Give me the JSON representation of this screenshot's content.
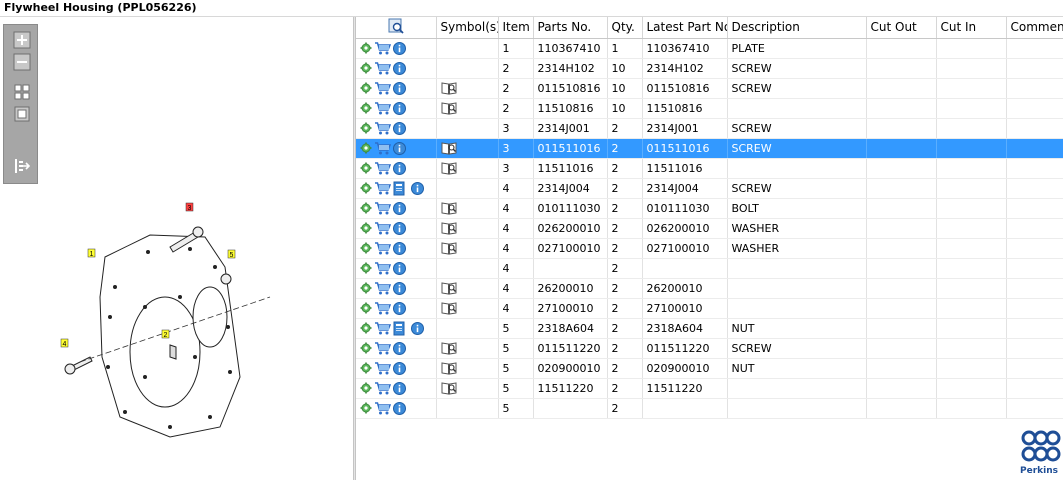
{
  "window": {
    "title": "Flywheel Housing (PPL056226)"
  },
  "table": {
    "columns": [
      "",
      "Symbol(s)",
      "Item",
      "Parts No.",
      "Qty.",
      "Latest Part No.",
      "Description",
      "Cut Out",
      "Cut In",
      "Comment"
    ],
    "rows": [
      {
        "symbol": "",
        "item": "1",
        "part_no": "110367410",
        "qty": "1",
        "latest": "110367410",
        "desc": "PLATE"
      },
      {
        "symbol": "",
        "item": "2",
        "part_no": "2314H102",
        "qty": "10",
        "latest": "2314H102",
        "desc": "SCREW"
      },
      {
        "symbol": "book",
        "item": "2",
        "part_no": "011510816",
        "qty": "10",
        "latest": "011510816",
        "desc": "SCREW"
      },
      {
        "symbol": "book",
        "item": "2",
        "part_no": "11510816",
        "qty": "10",
        "latest": "11510816",
        "desc": ""
      },
      {
        "symbol": "",
        "item": "3",
        "part_no": "2314J001",
        "qty": "2",
        "latest": "2314J001",
        "desc": "SCREW"
      },
      {
        "symbol": "book",
        "item": "3",
        "part_no": "011511016",
        "qty": "2",
        "latest": "011511016",
        "desc": "SCREW",
        "selected": true
      },
      {
        "symbol": "book",
        "item": "3",
        "part_no": "11511016",
        "qty": "2",
        "latest": "11511016",
        "desc": ""
      },
      {
        "symbol": "manual",
        "item": "4",
        "part_no": "2314J004",
        "qty": "2",
        "latest": "2314J004",
        "desc": "SCREW"
      },
      {
        "symbol": "book",
        "item": "4",
        "part_no": "010111030",
        "qty": "2",
        "latest": "010111030",
        "desc": "BOLT"
      },
      {
        "symbol": "book",
        "item": "4",
        "part_no": "026200010",
        "qty": "2",
        "latest": "026200010",
        "desc": "WASHER"
      },
      {
        "symbol": "book",
        "item": "4",
        "part_no": "027100010",
        "qty": "2",
        "latest": "027100010",
        "desc": "WASHER"
      },
      {
        "symbol": "",
        "item": "4",
        "part_no": "",
        "qty": "2",
        "latest": "",
        "desc": ""
      },
      {
        "symbol": "book",
        "item": "4",
        "part_no": "26200010",
        "qty": "2",
        "latest": "26200010",
        "desc": ""
      },
      {
        "symbol": "book",
        "item": "4",
        "part_no": "27100010",
        "qty": "2",
        "latest": "27100010",
        "desc": ""
      },
      {
        "symbol": "manual",
        "item": "5",
        "part_no": "2318A604",
        "qty": "2",
        "latest": "2318A604",
        "desc": "NUT"
      },
      {
        "symbol": "book",
        "item": "5",
        "part_no": "011511220",
        "qty": "2",
        "latest": "011511220",
        "desc": "SCREW"
      },
      {
        "symbol": "book",
        "item": "5",
        "part_no": "020900010",
        "qty": "2",
        "latest": "020900010",
        "desc": "NUT"
      },
      {
        "symbol": "book",
        "item": "5",
        "part_no": "11511220",
        "qty": "2",
        "latest": "11511220",
        "desc": ""
      },
      {
        "symbol": "",
        "item": "5",
        "part_no": "",
        "qty": "2",
        "latest": "",
        "desc": ""
      }
    ]
  },
  "drawing": {
    "callouts": [
      "1",
      "2",
      "3",
      "4",
      "5"
    ]
  },
  "logo": {
    "text": "Perkins"
  },
  "colors": {
    "selected_row": "#3399ff",
    "toolbar": "#a6a6a6",
    "gear": "#5cb85c",
    "cart": "#2f6fc9",
    "info": "#3c8ad8",
    "brand": "#1f4e96"
  }
}
